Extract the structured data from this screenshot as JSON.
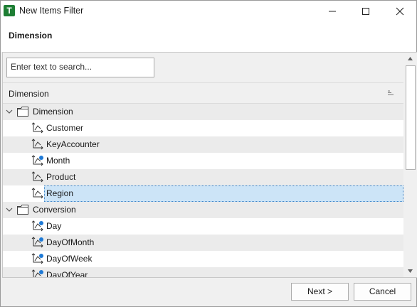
{
  "window": {
    "title": "New Items Filter",
    "app_icon_letter": "T"
  },
  "header": {
    "section_title": "Dimension"
  },
  "search": {
    "placeholder": "Enter text to search..."
  },
  "grid": {
    "column_header": "Dimension"
  },
  "tree": {
    "groups": [
      {
        "label": "Dimension",
        "expanded": true,
        "items": [
          {
            "label": "Customer",
            "icon": "dimension-icon"
          },
          {
            "label": "KeyAccounter",
            "icon": "dimension-icon"
          },
          {
            "label": "Month",
            "icon": "time-dimension-icon"
          },
          {
            "label": "Product",
            "icon": "dimension-icon"
          },
          {
            "label": "Region",
            "icon": "dimension-icon",
            "selected": true
          }
        ]
      },
      {
        "label": "Conversion",
        "expanded": true,
        "items": [
          {
            "label": "Day",
            "icon": "time-dimension-icon"
          },
          {
            "label": "DayOfMonth",
            "icon": "time-dimension-icon"
          },
          {
            "label": "DayOfWeek",
            "icon": "time-dimension-icon"
          },
          {
            "label": "DayOfYear",
            "icon": "time-dimension-icon"
          }
        ]
      }
    ]
  },
  "buttons": {
    "next": "Next >",
    "cancel": "Cancel"
  },
  "colors": {
    "selection": "#cce4f7",
    "app_icon": "#1e7e34",
    "accent_badge": "#1f7ad6"
  }
}
